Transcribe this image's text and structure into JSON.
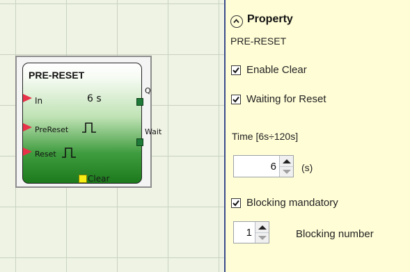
{
  "canvas": {
    "block": {
      "title": "PRE-RESET",
      "inputs": [
        "In",
        "PreReset",
        "Reset"
      ],
      "time_value": "6 s",
      "outputs": [
        "Q",
        "Wait"
      ],
      "clear_pin": "Clear",
      "colors": {
        "input_pin": "#e8324a",
        "output_pin": "#1f7a3a",
        "clear_pin": "#f6ee14"
      }
    }
  },
  "property_panel": {
    "title": "Property",
    "block_name": "PRE-RESET",
    "enable_clear": {
      "label": "Enable Clear",
      "checked": true
    },
    "waiting_for_reset": {
      "label": "Waiting for Reset",
      "checked": true
    },
    "time": {
      "label": "Time [6s÷120s]",
      "value": "6",
      "unit": "(s)"
    },
    "blocking_mandatory": {
      "label": "Blocking mandatory",
      "checked": true
    },
    "blocking_number": {
      "value": "1",
      "label": "Blocking number"
    },
    "background": "#fffdd6"
  }
}
